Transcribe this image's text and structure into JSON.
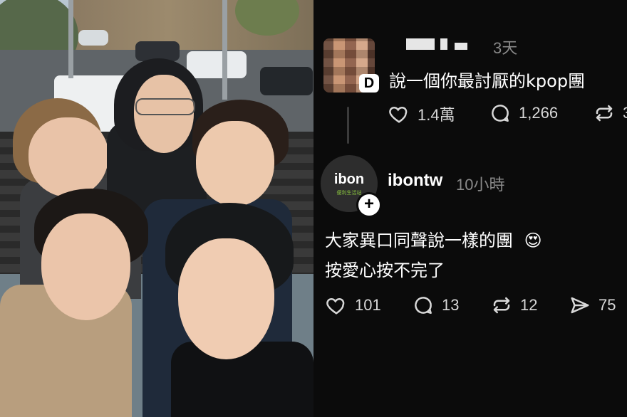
{
  "first_comment": {
    "username_masked": "",
    "avatar_badge": "D",
    "time": "3天",
    "text": "說一個你最討厭的kpop團",
    "likes": "1.4萬",
    "replies": "1,266",
    "reposts": "3"
  },
  "reply": {
    "avatar_logo_text": "ibon",
    "avatar_sub_text": "便利生活站",
    "username": "ibontw",
    "time": "10小時",
    "line1": "大家異口同聲說一樣的團",
    "emoji": "😍",
    "line2": "按愛心按不完了",
    "likes": "101",
    "replies": "13",
    "reposts": "12",
    "shares": "75"
  },
  "icons": {
    "like": "heart-icon",
    "reply": "comment-icon",
    "repost": "repost-icon",
    "share": "send-icon",
    "follow": "plus-icon"
  },
  "colors": {
    "panel_bg": "#0b0b0b",
    "text": "#ffffff",
    "muted": "#8a8a8a",
    "ibon_green": "#8ac43f"
  }
}
